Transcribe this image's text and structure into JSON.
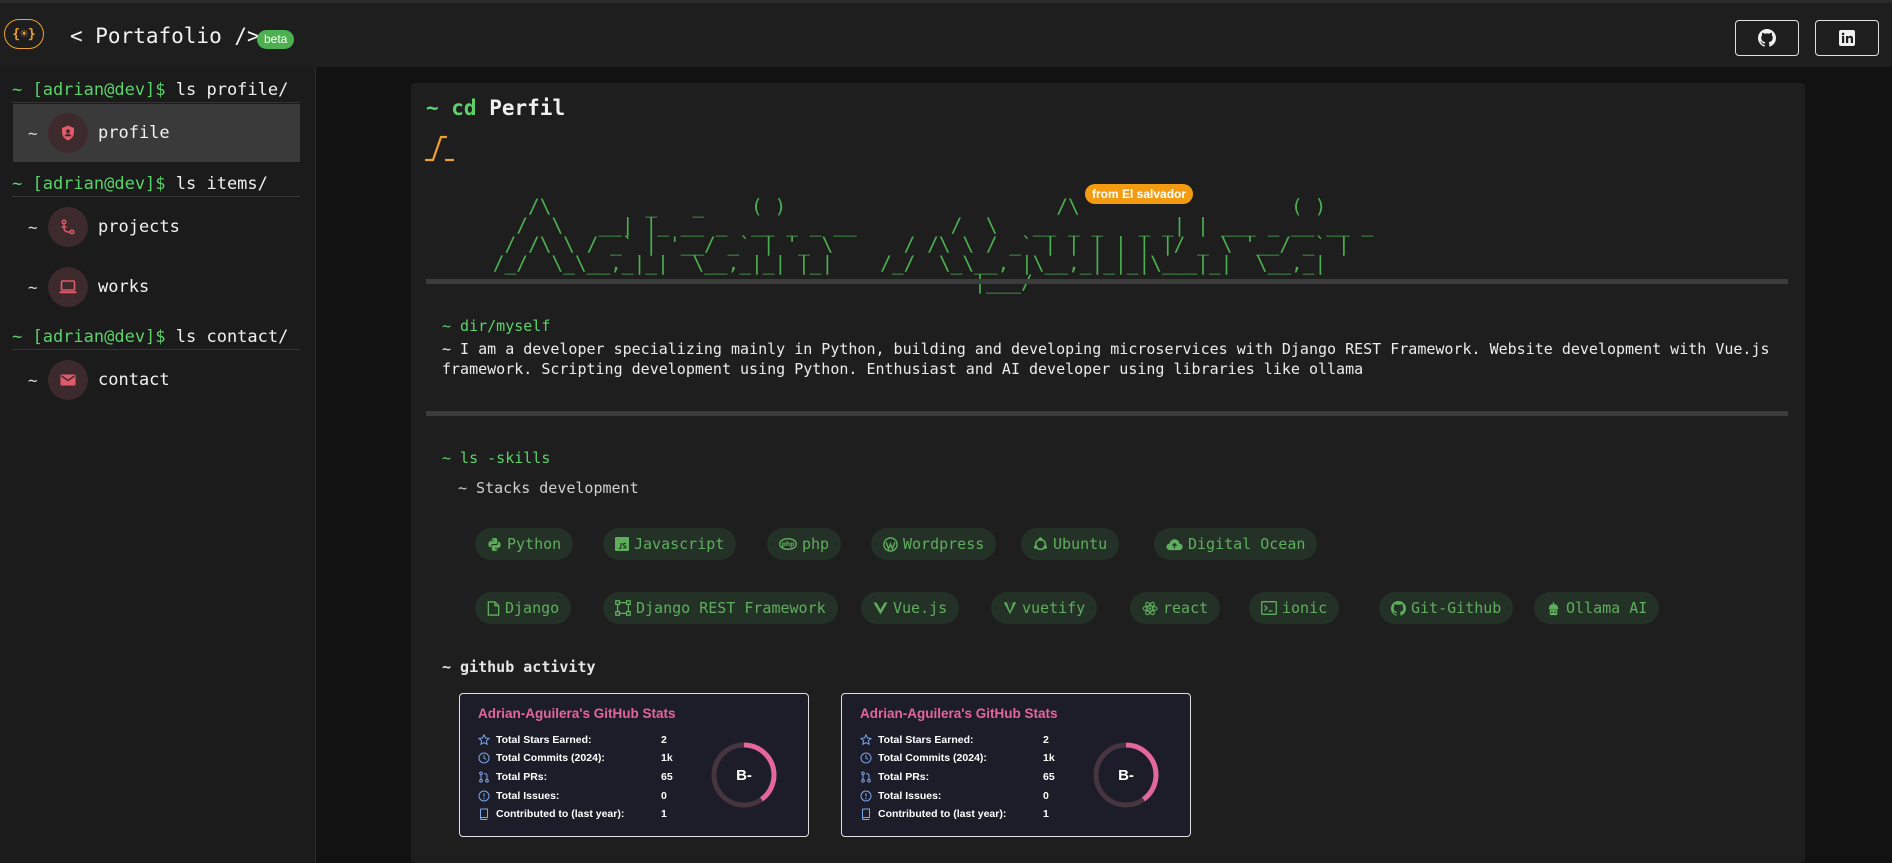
{
  "header": {
    "logo_text": "{☀}",
    "brand": "< Portafolio />",
    "badge": "beta",
    "github_button_icon": "github-icon",
    "linkedin_button_icon": "linkedin-icon"
  },
  "sidebar": {
    "sections": [
      {
        "user": "~ [adrian@dev]$",
        "cmd": " ls profile/"
      },
      {
        "user": "~ [adrian@dev]$",
        "cmd": " ls items/"
      },
      {
        "user": "~ [adrian@dev]$",
        "cmd": " ls contact/"
      }
    ],
    "items": [
      {
        "tilde": "~",
        "label": "profile",
        "icon": "account-shield-icon",
        "active": true
      },
      {
        "tilde": "~",
        "label": "projects",
        "icon": "source-branch-icon"
      },
      {
        "tilde": "~",
        "label": "works",
        "icon": "laptop-icon"
      },
      {
        "tilde": "~",
        "label": "contact",
        "icon": "email-icon"
      }
    ]
  },
  "main": {
    "title_prefix": "~ cd",
    "title": "Perfil",
    "prompt_symbol": "_/‾_",
    "ascii_name": "    /\\        _   _    ( )                       /\\                  ( )\n   /  \\   __| |_ __ _  __ _ _ __        /  \\   __ _ _   _ _| | ___ _ __ __ _\n  / /\\ \\ / _` | '__/ _` | '_ \\      / /\\ \\ / _` | | | | | |/ _ \\ '__/ _` |\n /_/  \\_\\__,_|_|  \\__,_|_| |_|    /_/  \\_\\__, |\\__,_|_|_|\\___|_|  \\__,_|\n                                          |___/",
    "origin_badge": "from El salvador",
    "about_cmd": "~ dir/myself",
    "about_text": "~ I am a developer specializing mainly in Python, building and developing microservices with Django REST Framework. Website development with Vue.js framework. Scripting development using Python. Enthusiast and AI developer using libraries like ollama",
    "skills_cmd": "~ ls -skills",
    "stacks_label": "~ Stacks development",
    "skills_row1": [
      "Python",
      "Javascript",
      "php",
      "Wordpress",
      "Ubuntu",
      "Digital Ocean"
    ],
    "skills_row2": [
      "Django",
      "Django REST Framework",
      "Vue.js",
      "vuetify",
      "react",
      "ionic",
      "Git-Github",
      "Ollama AI"
    ],
    "github_cmd": "~ github activity",
    "stats_cards": [
      {
        "title": "Adrian-Aguilera's GitHub Stats",
        "rows": [
          {
            "label": "Total Stars Earned:",
            "value": "2",
            "icon": "star-icon"
          },
          {
            "label": "Total Commits (2024):",
            "value": "1k",
            "icon": "clock-icon"
          },
          {
            "label": "Total PRs:",
            "value": "65",
            "icon": "pull-request-icon"
          },
          {
            "label": "Total Issues:",
            "value": "0",
            "icon": "issue-icon"
          },
          {
            "label": "Contributed to (last year):",
            "value": "1",
            "icon": "repo-icon"
          }
        ],
        "grade": "B-",
        "grade_progress": 0.4
      },
      {
        "title": "Adrian-Aguilera's GitHub Stats",
        "rows": [
          {
            "label": "Total Stars Earned:",
            "value": "2",
            "icon": "star-icon"
          },
          {
            "label": "Total Commits (2024):",
            "value": "1k",
            "icon": "clock-icon"
          },
          {
            "label": "Total PRs:",
            "value": "65",
            "icon": "pull-request-icon"
          },
          {
            "label": "Total Issues:",
            "value": "0",
            "icon": "issue-icon"
          },
          {
            "label": "Contributed to (last year):",
            "value": "1",
            "icon": "repo-icon"
          }
        ],
        "grade": "B-",
        "grade_progress": 0.4
      }
    ]
  },
  "colors": {
    "accent_green": "#5bd36a",
    "accent_orange": "#f0a030",
    "stats_title": "#e4669a",
    "icon_pink": "#e05a6a"
  }
}
